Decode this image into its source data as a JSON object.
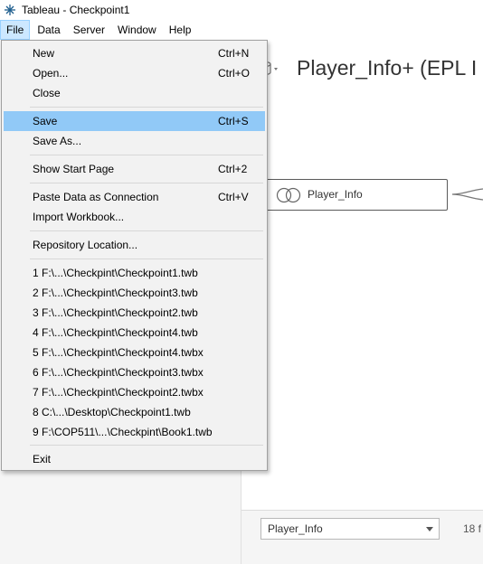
{
  "window": {
    "title": "Tableau - Checkpoint1",
    "app_icon": "tableau-logo-icon"
  },
  "menubar": {
    "items": [
      "File",
      "Data",
      "Server",
      "Window",
      "Help"
    ],
    "active": "File"
  },
  "datasource": {
    "title": "Player_Info+ (EPL I",
    "table_node": "Player_Info"
  },
  "bottom": {
    "table_select": "Player_Info",
    "field_count": "18 f"
  },
  "file_menu": {
    "new": {
      "label": "New",
      "shortcut": "Ctrl+N"
    },
    "open": {
      "label": "Open...",
      "shortcut": "Ctrl+O"
    },
    "close": {
      "label": "Close"
    },
    "save": {
      "label": "Save",
      "shortcut": "Ctrl+S"
    },
    "save_as": {
      "label": "Save As..."
    },
    "show_start_page": {
      "label": "Show Start Page",
      "shortcut": "Ctrl+2"
    },
    "paste_data": {
      "label": "Paste Data as Connection",
      "shortcut": "Ctrl+V"
    },
    "import_workbook": {
      "label": "Import Workbook..."
    },
    "repository_location": {
      "label": "Repository Location..."
    },
    "recent": [
      "1 F:\\...\\Checkpint\\Checkpoint1.twb",
      "2 F:\\...\\Checkpint\\Checkpoint3.twb",
      "3 F:\\...\\Checkpint\\Checkpoint2.twb",
      "4 F:\\...\\Checkpint\\Checkpoint4.twb",
      "5 F:\\...\\Checkpint\\Checkpoint4.twbx",
      "6 F:\\...\\Checkpint\\Checkpoint3.twbx",
      "7 F:\\...\\Checkpint\\Checkpoint2.twbx",
      "8 C:\\...\\Desktop\\Checkpoint1.twb",
      "9 F:\\COP511\\...\\Checkpint\\Book1.twb"
    ],
    "exit": {
      "label": "Exit"
    }
  },
  "colors": {
    "highlight": "#91c9f7",
    "menu_bg": "#f2f2f2",
    "active_menu": "#cce8ff"
  }
}
